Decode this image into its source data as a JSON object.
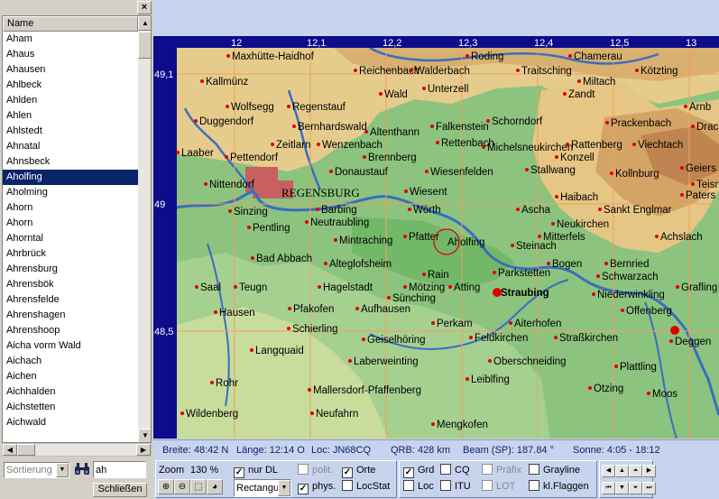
{
  "list": {
    "header": "Name",
    "items": [
      "Aham",
      "Ahaus",
      "Ahausen",
      "Ahlbeck",
      "Ahlden",
      "Ahlen",
      "Ahlstedt",
      "Ahnatal",
      "Ahnsbeck",
      "Aholfing",
      "Aholming",
      "Ahorn",
      "Ahorn",
      "Ahorntal",
      "Ahrbrück",
      "Ahrensburg",
      "Ahrensbök",
      "Ahrensfelde",
      "Ahrenshagen",
      "Ahrenshoop",
      "Aicha vorm Wald",
      "Aichach",
      "Aichen",
      "Aichhalden",
      "Aichstetten",
      "Aichwald"
    ],
    "selected_index": 9
  },
  "close_label": "×",
  "sort_placeholder": "Sortierung",
  "search_value": "ah",
  "close_button_label": "Schließen",
  "map": {
    "top_ticks": [
      "12",
      "12,1",
      "12,2",
      "12,3",
      "12,4",
      "12,5",
      "13"
    ],
    "left_ticks": [
      "49,1",
      "49",
      "48,5"
    ],
    "major_city": "REGENSBURG",
    "marked_town": "Aholfing",
    "towns": [
      "Maxhütte-Haidhof",
      "Roding",
      "Chamerau",
      "Reichenbach",
      "Walderbach",
      "Traitsching",
      "Kötzting",
      "Kallmünz",
      "Miltach",
      "Wolfsegg",
      "Regenstauf",
      "Schorndorf",
      "Zandt",
      "Wald",
      "Unterzell",
      "Arnb",
      "Duggendorf",
      "Bernhardswald",
      "Altenthann",
      "Michelsneukirchen",
      "Prackenbach",
      "Falkenstein",
      "Drac",
      "Laaber",
      "Pettendorf",
      "Zeitlarn",
      "Wenzenbach",
      "Rettenbach",
      "Rattenberg",
      "Viechtach",
      "Brennberg",
      "Konzell",
      "Donaustauf",
      "Wiesenfelden",
      "Stallwang",
      "Kollnburg",
      "Geiers",
      "Nittendorf",
      "Teisn",
      "Wiesent",
      "Haibach",
      "Paters",
      "Sinzing",
      "Barbing",
      "Wörth",
      "Ascha",
      "Sankt Englmar",
      "Neutraubling",
      "Neukirchen",
      "Pentling",
      "Pfatter",
      "Mitterfels",
      "Achslach",
      "Mintraching",
      "Steinach",
      "Bad Abbach",
      "Alteglofsheim",
      "Bogen",
      "Bernried",
      "Schwarzach",
      "Saal",
      "Teugn",
      "Hagelstadt",
      "Rain",
      "Parkstetten",
      "Grafling",
      "Mötzing",
      "Atting",
      "Straubing",
      "Niederwinkling",
      "Sünching",
      "Hausen",
      "Pfakofen",
      "Aufhausen",
      "Offenberg",
      "Schierling",
      "Perkam",
      "Aiterhofen",
      "Deggen",
      "Langquaid",
      "Geiselhöring",
      "Feldkirchen",
      "Straßkirchen",
      "Laberweinting",
      "Oberschneiding",
      "Plattling",
      "Rohr",
      "Leiblfing",
      "Mallersdorf-Pfaffenberg",
      "Otzing",
      "Moos",
      "Wildenberg",
      "Neufahrn",
      "Mengkofen"
    ]
  },
  "status": {
    "breite": "Breite: 48:42 N",
    "laenge": "Länge: 12:14 O",
    "loc": "Loc: JN68CQ",
    "qrb": "QRB: 428 km",
    "beam": "Beam (SP): 187.84 °",
    "sonne": "Sonne:   4:05 - 18:12"
  },
  "controls": {
    "zoom_label": "Zoom",
    "zoom_value": "130 %",
    "mode_value": "Rectangu",
    "checks": {
      "nur_dl": "nur DL",
      "polit": "polit.",
      "orte": "Orte",
      "phys": "phys.",
      "locstat": "LocStat",
      "grd": "Grd",
      "loc": "Loc",
      "cq": "CQ",
      "itu": "ITU",
      "praefix": "Präfix",
      "lot": "LOT",
      "grayline": "Grayline",
      "klflaggen": "kl.Flaggen"
    }
  },
  "colors": {
    "selection": "#0a246a",
    "map_border": "#0c0c8c",
    "panel_blue": "#c8d4ee",
    "river": "#3a6ec0",
    "town_dot": "#e00000"
  }
}
